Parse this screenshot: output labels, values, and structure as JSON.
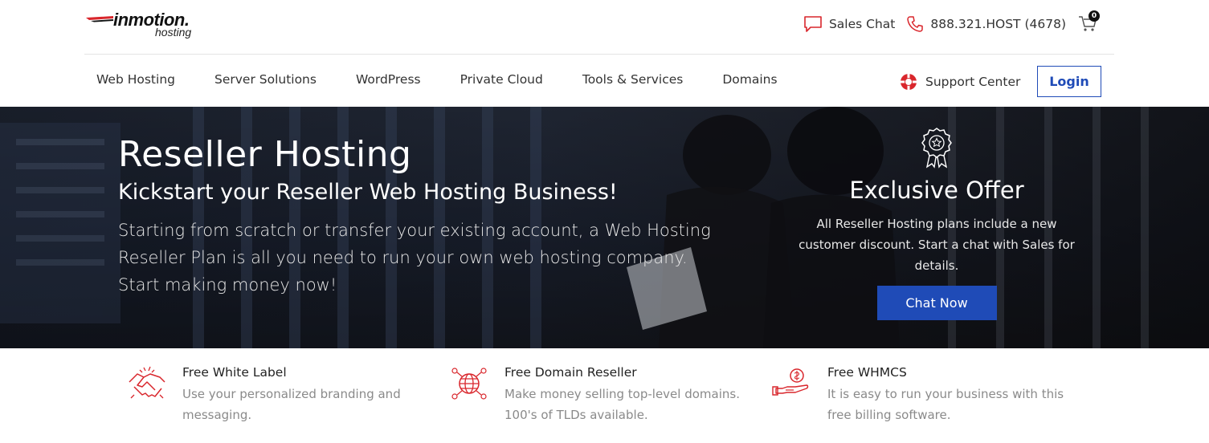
{
  "brand": {
    "logo_main": "inmotion.",
    "logo_sub": "hosting"
  },
  "topbar": {
    "sales_chat": "Sales Chat",
    "phone": "888.321.HOST (4678)",
    "cart_count": "0"
  },
  "nav": {
    "items": [
      "Web Hosting",
      "Server Solutions",
      "WordPress",
      "Private Cloud",
      "Tools & Services",
      "Domains"
    ],
    "support": "Support Center",
    "login": "Login"
  },
  "hero": {
    "title": "Reseller Hosting",
    "subtitle": "Kickstart your Reseller Web Hosting Business!",
    "description": "Starting from scratch or transfer your existing account, a Web Hosting Reseller Plan is all you need to run your own web hosting company. Start making money now!",
    "offer": {
      "title": "Exclusive Offer",
      "text": "All Reseller Hosting plans include a new customer discount. Start a chat with Sales for details.",
      "button": "Chat Now"
    }
  },
  "features": [
    {
      "icon": "handshake-icon",
      "title": "Free White Label",
      "desc": "Use your personalized branding and messaging."
    },
    {
      "icon": "globe-icon",
      "title": "Free Domain Reseller",
      "desc": "Make money selling top-level domains. 100's of TLDs available."
    },
    {
      "icon": "billing-icon",
      "title": "Free WHMCS",
      "desc": "It is easy to run your business with this free billing software."
    }
  ],
  "colors": {
    "accent_blue": "#1f4bb7",
    "icon_red": "#d9262c"
  }
}
